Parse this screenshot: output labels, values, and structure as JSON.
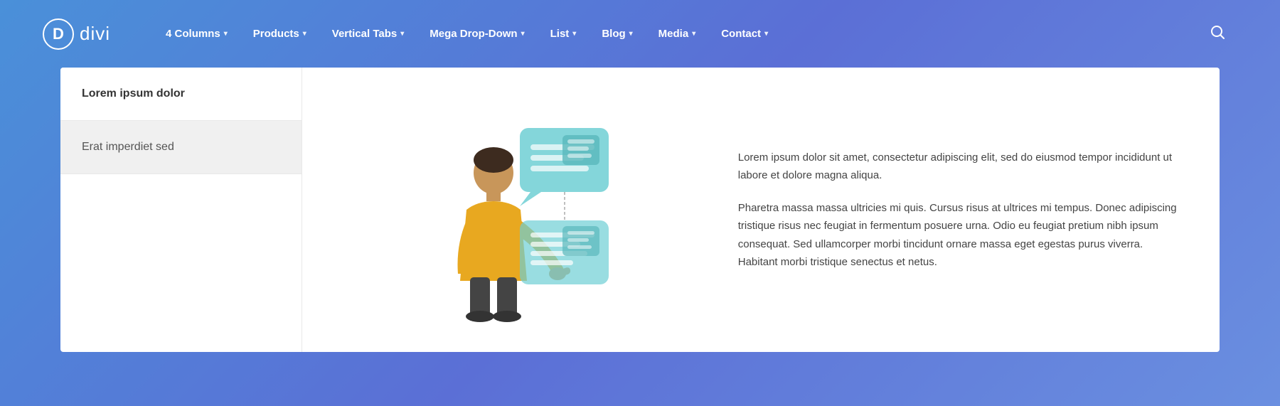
{
  "header": {
    "logo_letter": "D",
    "logo_text": "divi",
    "search_icon": "🔍"
  },
  "nav": {
    "items": [
      {
        "label": "4 Columns",
        "has_chevron": true
      },
      {
        "label": "Products",
        "has_chevron": true
      },
      {
        "label": "Vertical Tabs",
        "has_chevron": true
      },
      {
        "label": "Mega Drop-Down",
        "has_chevron": true
      },
      {
        "label": "List",
        "has_chevron": true
      },
      {
        "label": "Blog",
        "has_chevron": true
      },
      {
        "label": "Media",
        "has_chevron": true
      },
      {
        "label": "Contact",
        "has_chevron": true
      }
    ]
  },
  "sidebar": {
    "items": [
      {
        "label": "Lorem ipsum dolor",
        "style": "active"
      },
      {
        "label": "Erat imperdiet sed",
        "style": "secondary"
      }
    ]
  },
  "text": {
    "paragraph1": "Lorem ipsum dolor sit amet, consectetur adipiscing elit, sed do eiusmod tempor incididunt ut labore et dolore magna aliqua.",
    "paragraph2": "Pharetra massa massa ultricies mi quis. Cursus risus at ultrices mi tempus. Donec adipiscing tristique risus nec feugiat in fermentum posuere urna. Odio eu feugiat pretium nibh ipsum consequat. Sed ullamcorper morbi tincidunt ornare massa eget egestas purus viverra. Habitant morbi tristique senectus et netus."
  },
  "colors": {
    "accent_blue": "#5b9bd5",
    "teal": "#6ec6c9",
    "bg_gradient_start": "#4a90d9",
    "bg_gradient_end": "#6a8fe0"
  }
}
